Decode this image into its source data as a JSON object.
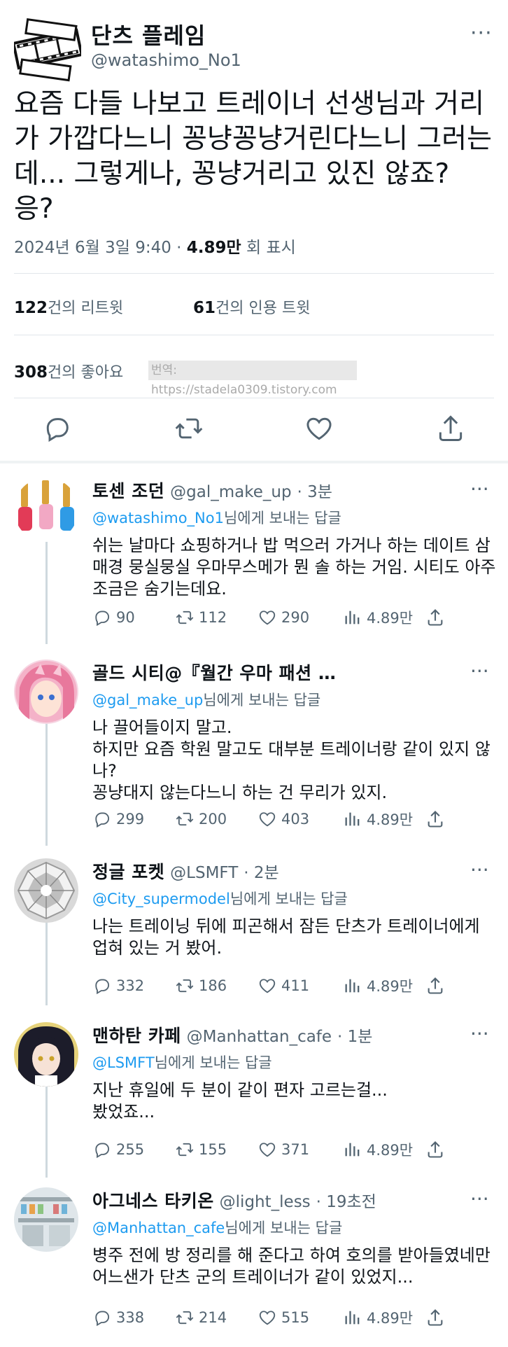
{
  "main_tweet": {
    "name": "단츠 플레임",
    "handle": "@watashimo_No1",
    "text": "요즘 다들 나보고 트레이너 선생님과 거리가 가깝다느니 꽁냥꽁냥거린다느니 그러는데... 그렇게나, 꽁냥거리고 있진 않죠? 응?",
    "date": "2024년 6월 3일 9:40 ·",
    "views_count": "4.89만",
    "views_label": "회 표시",
    "retweets_count": "122",
    "retweets_label": "건의 리트윗",
    "quotes_count": "61",
    "quotes_label": "건의 인용 트윗",
    "likes_count": "308",
    "likes_label": "건의 좋아요",
    "watermark": "번역: https://stadela0309.tistory.com",
    "more": "···"
  },
  "replies": [
    {
      "name": "토센 조던",
      "handle": "@gal_make_up",
      "time": "· 3분",
      "to_handle": "@watashimo_No1",
      "to_suffix": "님에게 보내는 답글",
      "text": "쉬는 날마다 쇼핑하거나 밥 먹으러 가거나 하는 데이트 삼매경 뭉실뭉실 우마무스메가 뭔 솔 하는 거임. 시티도 아주 조금은 숨기는데요.",
      "replies": "90",
      "retweets": "112",
      "likes": "290",
      "views": "4.89만",
      "avatar_icon": "nail-polish-icon"
    },
    {
      "name": "골드 시티@『월간 우마 패션 …",
      "handle": "",
      "time": "",
      "to_handle": "@gal_make_up",
      "to_suffix": "님에게 보내는 답글",
      "text": "나 끌어들이지 말고.\n하지만 요즘 학원 말고도 대부분 트레이너랑 같이 있지 않나?\n꽁냥대지 않는다느니 하는 건 무리가 있지.",
      "replies": "299",
      "retweets": "200",
      "likes": "403",
      "views": "4.89만",
      "avatar_icon": "anime-girl-pink-icon"
    },
    {
      "name": "정글 포켓",
      "handle": "@LSMFT",
      "time": "· 2분",
      "to_handle": "@City_supermodel",
      "to_suffix": "님에게 보내는 답글",
      "text": "나는 트레이닝 뒤에 피곤해서 잠든 단츠가 트레이너에게 업혀 있는 거 봤어.",
      "replies": "332",
      "retweets": "186",
      "likes": "411",
      "views": "4.89만",
      "avatar_icon": "diamond-icon"
    },
    {
      "name": "맨하탄 카페",
      "handle": "@Manhattan_cafe",
      "time": "· 1분",
      "to_handle": "@LSMFT",
      "to_suffix": "님에게 보내는 답글",
      "text": "지난 휴일에 두 분이 같이 편자 고르는걸...\n봤었죠...",
      "replies": "255",
      "retweets": "155",
      "likes": "371",
      "views": "4.89만",
      "avatar_icon": "anime-girl-dark-icon"
    },
    {
      "name": "아그네스 타키온",
      "handle": "@light_less",
      "time": "· 19초전",
      "to_handle": "@Manhattan_cafe",
      "to_suffix": "님에게 보내는 답글",
      "text": "병주 전에 방 정리를 해 준다고 하여 호의를 받아들였네만 어느샌가 단츠 군의 트레이너가 같이 있었지...",
      "replies": "338",
      "retweets": "214",
      "likes": "515",
      "views": "4.89만",
      "avatar_icon": "laboratory-icon"
    }
  ],
  "colors": {
    "text": "#0f1419",
    "secondary": "#536471",
    "link": "#1d9bf0",
    "divider": "#eff3f4"
  }
}
